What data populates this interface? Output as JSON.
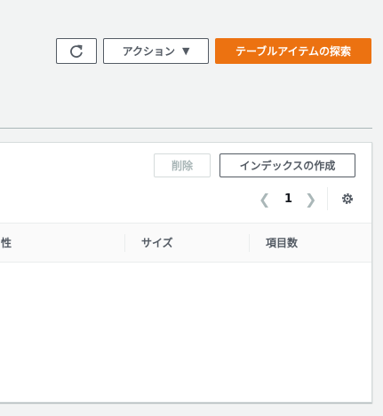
{
  "toolbar": {
    "actions_label": "アクション",
    "explore_label": "テーブルアイテムの探索"
  },
  "indexes": {
    "delete_label": "削除",
    "create_label": "インデックスの作成",
    "page": "1",
    "columns": [
      "性",
      "サイズ",
      "項目数"
    ]
  },
  "colors": {
    "primary": "#ec7211",
    "border": "#545b64",
    "disabled": "#aab7b8"
  }
}
